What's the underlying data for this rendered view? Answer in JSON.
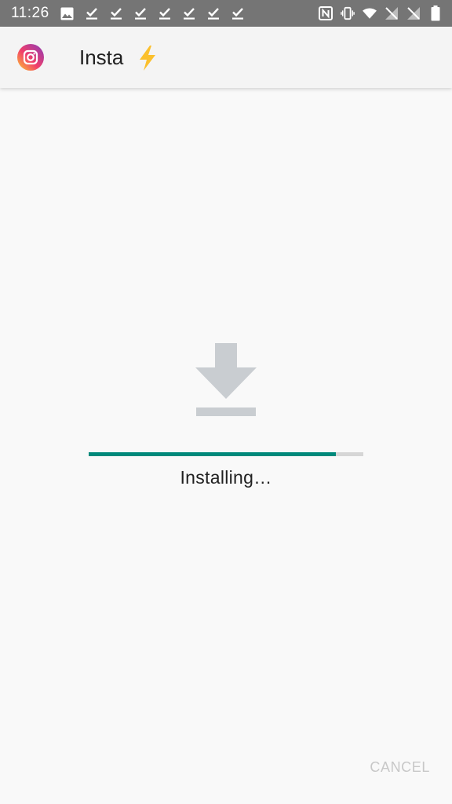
{
  "status_bar": {
    "time": "11:26",
    "left_icons": [
      "image-icon",
      "download-done-icon",
      "download-done-icon",
      "download-done-icon",
      "download-done-icon",
      "download-done-icon",
      "download-done-icon",
      "download-done-icon"
    ],
    "right_icons": [
      "nfc-icon",
      "vibrate-icon",
      "wifi-icon",
      "no-signal-icon",
      "no-signal-icon",
      "battery-icon"
    ]
  },
  "app_bar": {
    "logo": "instagram-logo-icon",
    "title": "Insta",
    "badge": "lightning-bolt-icon"
  },
  "install": {
    "icon": "download-icon",
    "progress": 0.9,
    "status_text": "Installing…"
  },
  "footer": {
    "cancel_label": "CANCEL"
  },
  "colors": {
    "status_bar": "#757575",
    "progress_fill": "#00897b",
    "progress_track": "#d6d6d6",
    "cancel_disabled": "#c8c8c8",
    "bolt": "#fbc02d"
  }
}
